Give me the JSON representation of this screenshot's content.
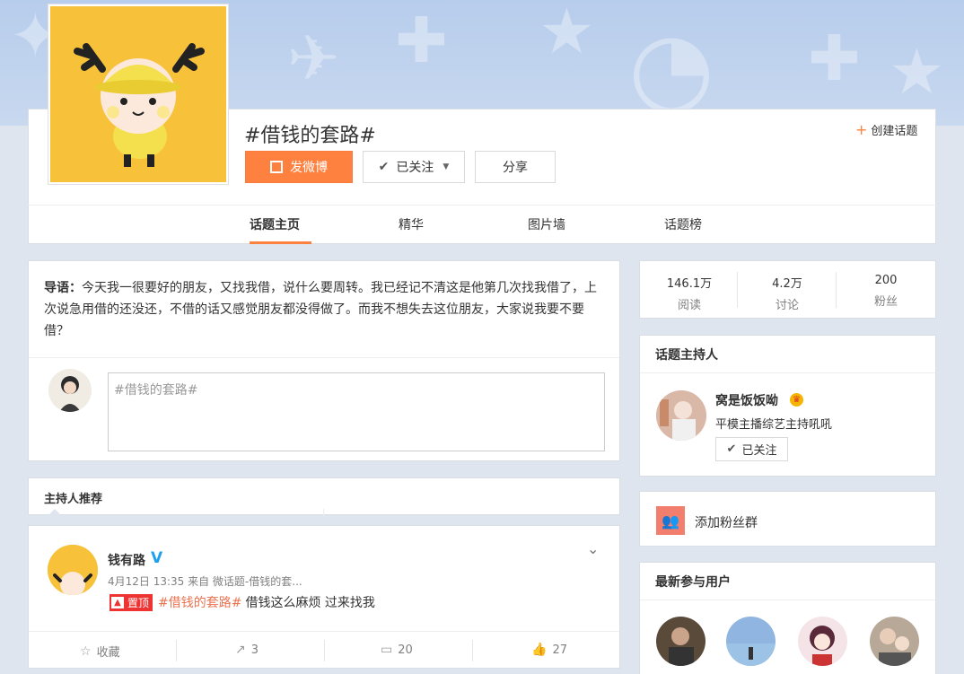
{
  "topic": {
    "title": "#借钱的套路#",
    "post_label": "发微博",
    "follow_label": "已关注",
    "share_label": "分享",
    "create_topic_label": "创建话题"
  },
  "tabs": [
    {
      "label": "话题主页",
      "active": true
    },
    {
      "label": "精华",
      "active": false
    },
    {
      "label": "图片墙",
      "active": false
    },
    {
      "label": "话题榜",
      "active": false
    }
  ],
  "intro": {
    "prefix": "导语：",
    "text": "今天我一很要好的朋友，又找我借，说什么要周转。我已经记不清这是他第几次找我借了，上次说急用借的还没还，不借的话又感觉朋友都没得做了。而我不想失去这位朋友，大家说我要不要借？"
  },
  "compose": {
    "placeholder": "#借钱的套路#"
  },
  "host_recommend": {
    "title": "主持人推荐"
  },
  "post": {
    "author": "钱有路",
    "meta": "4月12日 13:35 来自 微话题-借钱的套...",
    "pin_label": "置顶",
    "tag": "#借钱的套路#",
    "text": "借钱这么麻烦 过来找我",
    "actions": {
      "favorite": "收藏",
      "repost": "3",
      "comment": "20",
      "like": "27"
    }
  },
  "stats": [
    {
      "num": "146.1万",
      "label": "阅读"
    },
    {
      "num": "4.2万",
      "label": "讨论"
    },
    {
      "num": "200",
      "label": "粉丝"
    }
  ],
  "host": {
    "title": "话题主持人",
    "name": "窝是饭饭呦",
    "desc": "平模主播综艺主持吼吼",
    "follow_label": "已关注"
  },
  "fans": {
    "label": "添加粉丝群"
  },
  "latest": {
    "title": "最新参与用户"
  },
  "colors": {
    "accent": "#ff8140",
    "tag": "#eb7350",
    "verified": "#1ea0f0"
  }
}
